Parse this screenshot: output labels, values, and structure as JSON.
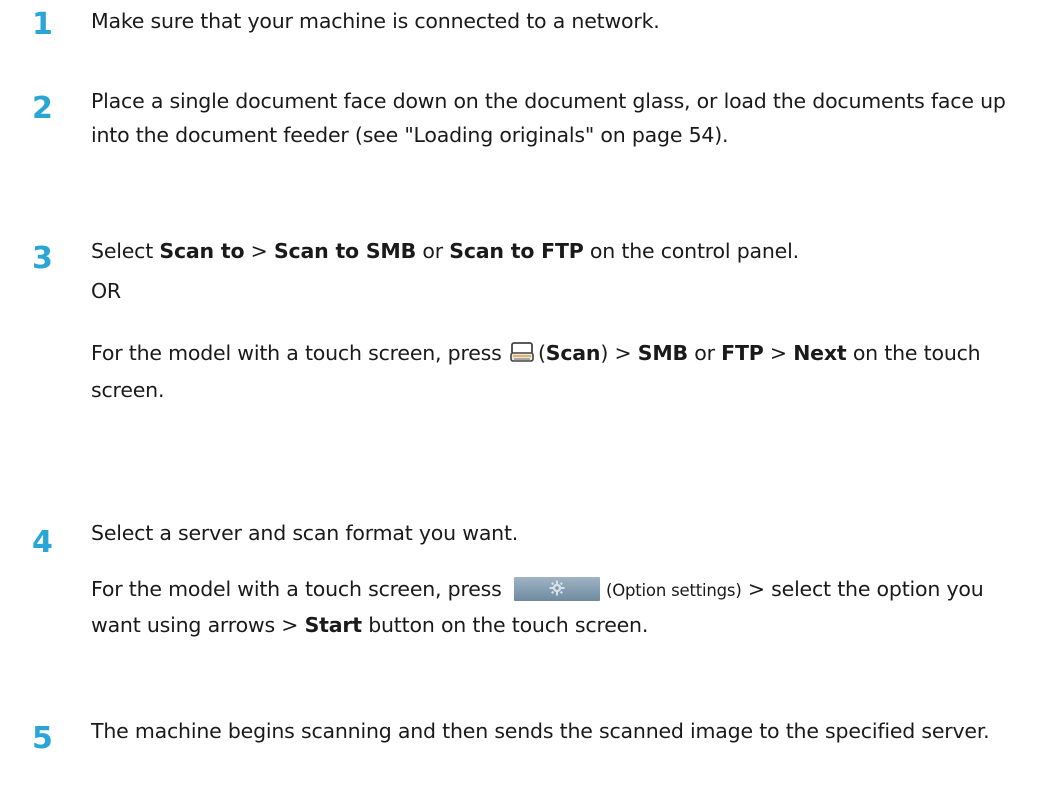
{
  "steps": [
    {
      "num": "1",
      "text": "Make sure that your machine is connected to a network."
    },
    {
      "num": "2",
      "text": "Place a single document face down on the document glass, or load the documents face up into the document feeder (see \"Loading originals\" on page 54)."
    },
    {
      "num": "3",
      "select": "Select",
      "scan_to": "Scan to",
      "gt1": " > ",
      "scan_smb": "Scan to SMB",
      "or1": " or ",
      "scan_ftp": "Scan to FTP",
      "end1": " on the control panel.",
      "or_label": "OR",
      "touch_prefix": "For the model with a touch screen, press ",
      "scan_paren_open": "(",
      "scan_label": "Scan",
      "scan_paren_close": ") > ",
      "smb": "SMB",
      "or2": " or ",
      "ftp": "FTP",
      "gt2": " > ",
      "next": "Next",
      "end2": " on the touch screen."
    },
    {
      "num": "4",
      "text": "Select a server and scan format you want.",
      "touch_prefix": "For the model with a touch screen, press ",
      "option_label": "(Option settings)",
      "mid": " > select the option you want using arrows > ",
      "start": "Start",
      "end": " button on the touch screen."
    },
    {
      "num": "5",
      "text": "The machine begins scanning and then sends the scanned image to the specified server."
    }
  ],
  "icons": {
    "scan": "scanner-icon",
    "options": "gear-icon"
  }
}
